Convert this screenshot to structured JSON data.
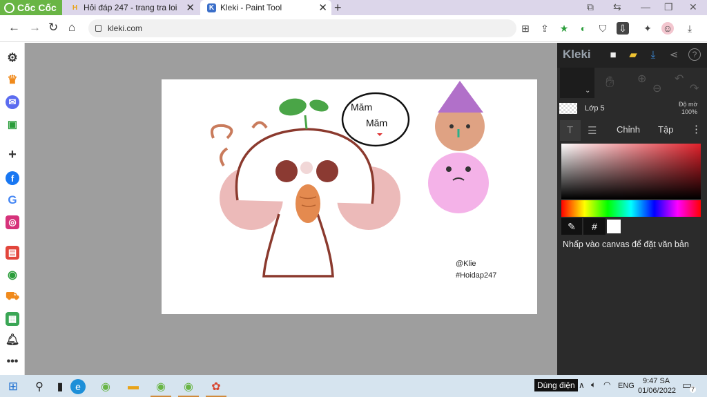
{
  "browser": {
    "brand": "Cốc Cốc",
    "tabs": [
      {
        "title": "Hỏi đáp 247 - trang tra loi",
        "icon": "hoidap-favicon",
        "close": "✕"
      },
      {
        "title": "Kleki - Paint Tool",
        "icon": "kleki-favicon",
        "close": "✕"
      }
    ],
    "new_tab": "+",
    "url": "kleki.com"
  },
  "app": {
    "name": "Kleki",
    "layer": {
      "name": "Lớp 5",
      "opacity_label": "Độ mờ",
      "opacity_value": "100%"
    },
    "tabs": {
      "adjust": "Chỉnh",
      "file": "Tập"
    },
    "hex_symbol": "#",
    "hint": "Nhấp vào canvas để đặt văn bản",
    "colors": {
      "panel": "#2b2b2b",
      "picker_hue": "#e0202a"
    }
  },
  "artwork": {
    "speech": [
      "Măm",
      "Măm"
    ],
    "signature": [
      "@Klie",
      "#Hoidap247"
    ]
  },
  "taskbar": {
    "tooltip": "Dùng điện",
    "lang": "ENG",
    "time": "9:47 SA",
    "date": "01/06/2022",
    "notifications": "7"
  }
}
